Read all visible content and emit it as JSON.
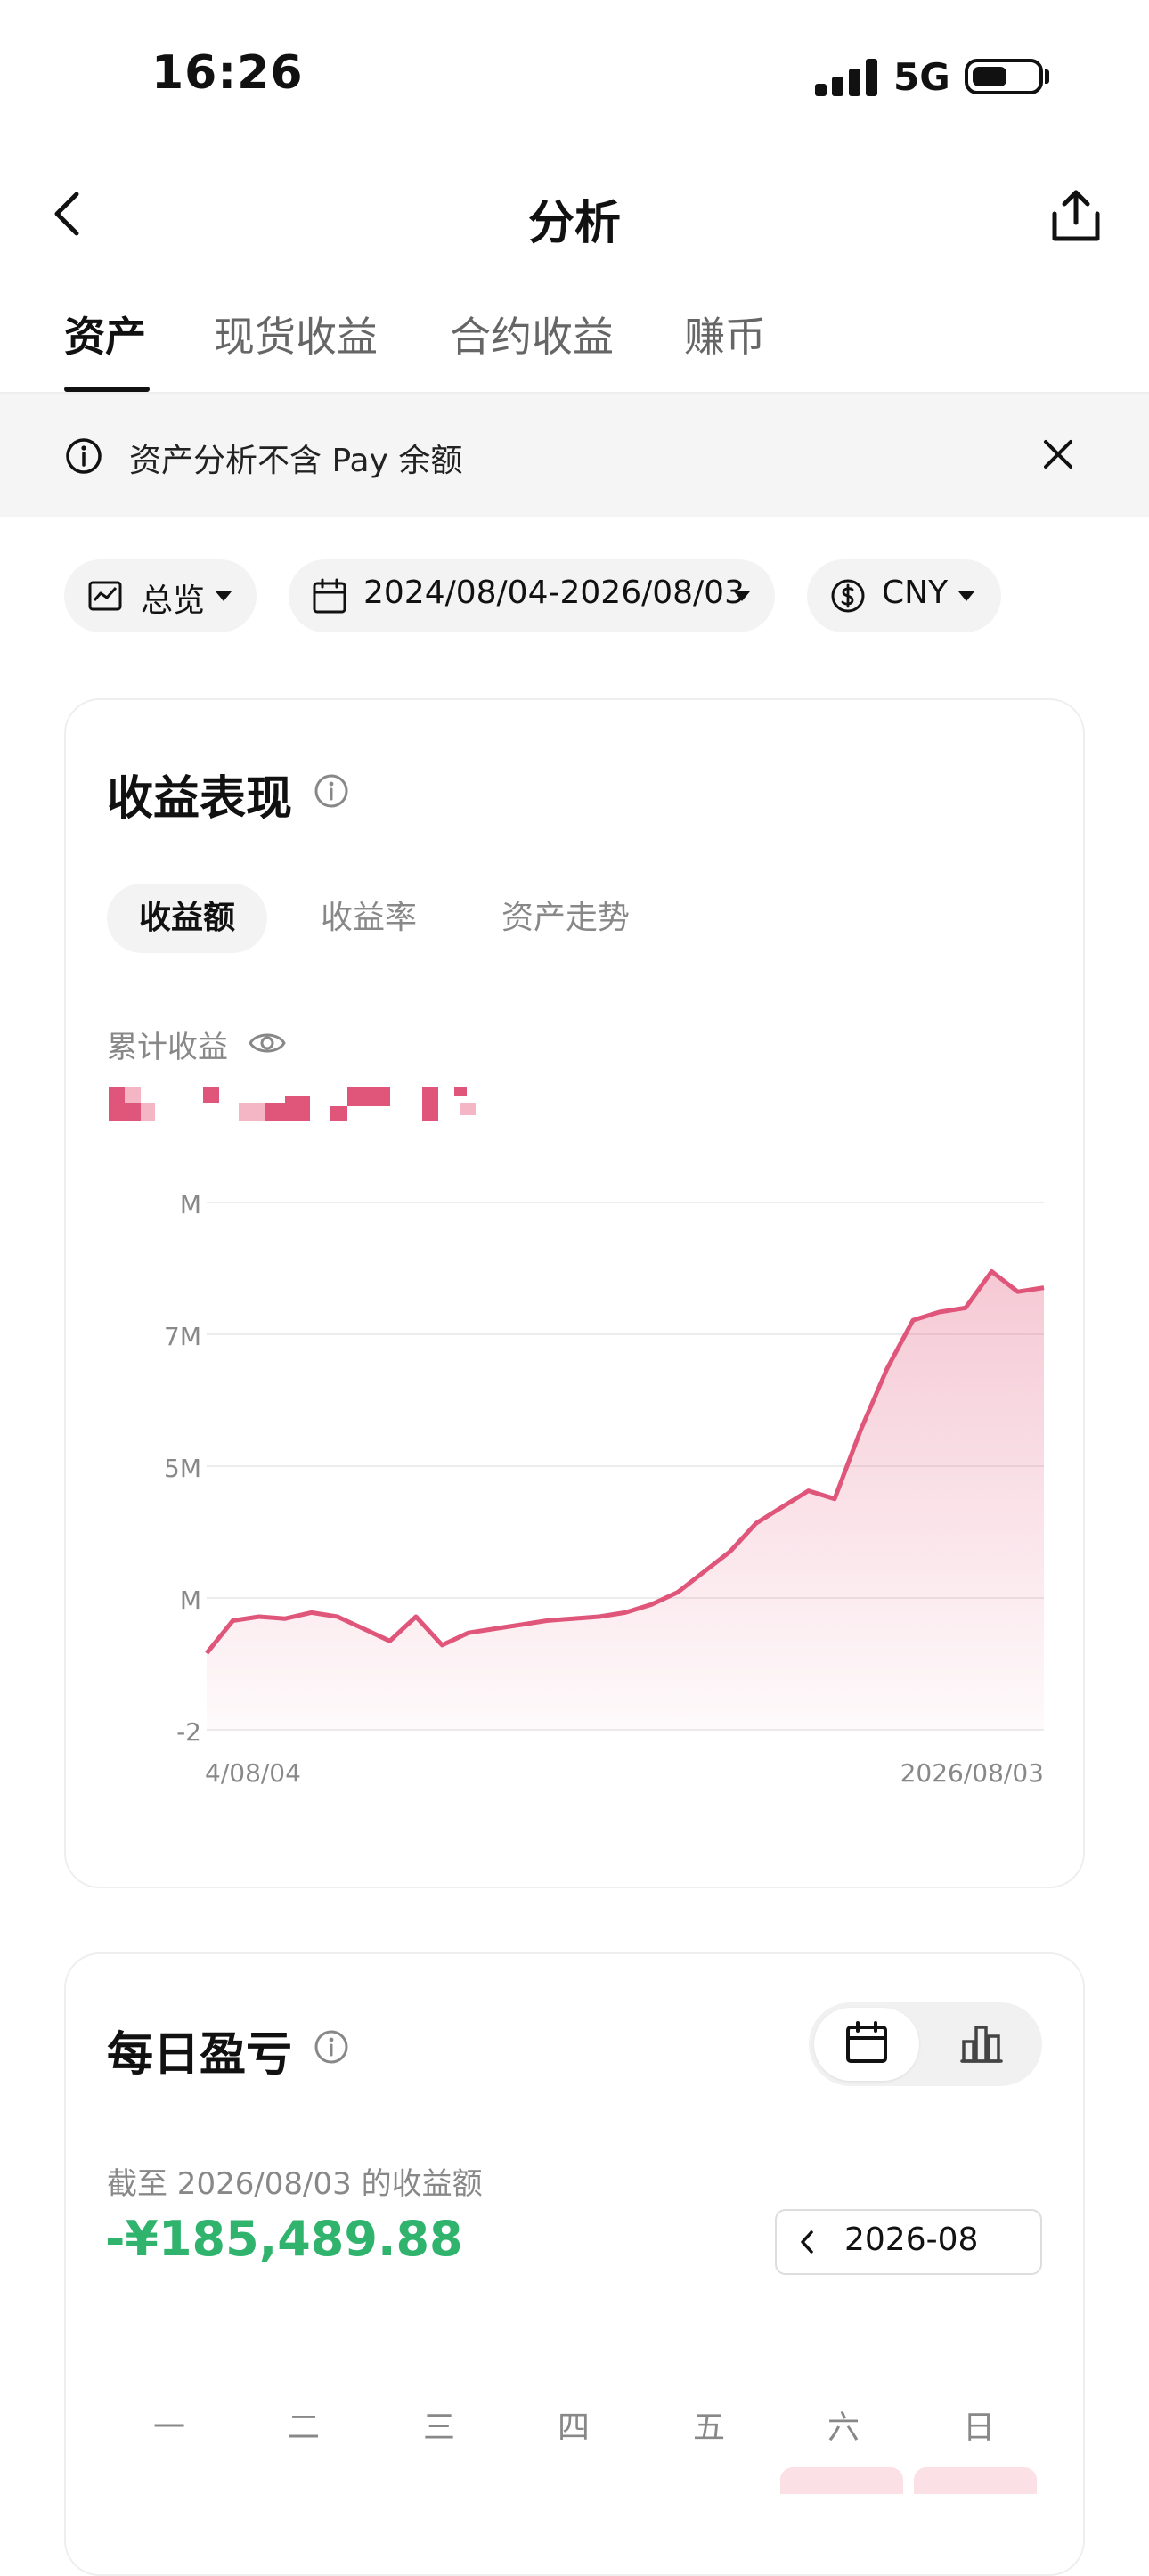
{
  "status_bar": {
    "time": "16:26",
    "network": "5G",
    "icons": [
      "signal-icon",
      "battery-icon"
    ]
  },
  "nav": {
    "title": "分析",
    "icons": [
      "back-icon",
      "share-icon"
    ]
  },
  "tabs": [
    {
      "label": "资产",
      "active": true
    },
    {
      "label": "现货收益",
      "active": false
    },
    {
      "label": "合约收益",
      "active": false
    },
    {
      "label": "赚币",
      "active": false
    }
  ],
  "notice": {
    "text": "资产分析不含 Pay 余额",
    "icons": [
      "info-icon",
      "close-icon"
    ]
  },
  "filters": {
    "view": "总览",
    "date_range": "2024/08/04-2026/08/03",
    "currency": "CNY"
  },
  "performance": {
    "title": "收益表现",
    "segments": [
      {
        "label": "收益额",
        "active": true
      },
      {
        "label": "收益率",
        "active": false
      },
      {
        "label": "资产走势",
        "active": false
      }
    ],
    "cumulative_label": "累计收益"
  },
  "chart_data": {
    "type": "area",
    "x_start_label": "4/08/04",
    "x_end_label": "2026/08/03",
    "y_tick_labels": [
      "-2",
      "M",
      "5M",
      "7M",
      "M"
    ],
    "grid": true,
    "color": "#e0567a",
    "series_shape": [
      0.0,
      0.08,
      0.09,
      0.085,
      0.1,
      0.09,
      0.06,
      0.03,
      0.09,
      0.02,
      0.05,
      0.06,
      0.07,
      0.08,
      0.085,
      0.09,
      0.1,
      0.12,
      0.15,
      0.2,
      0.25,
      0.32,
      0.36,
      0.4,
      0.38,
      0.55,
      0.7,
      0.82,
      0.84,
      0.85,
      0.94,
      0.89,
      0.9
    ]
  },
  "daily_pnl": {
    "title": "每日盈亏",
    "as_of": "截至 2026/08/03 的收益额",
    "value": "-¥185,489.88",
    "month": "2026-08",
    "weekdays": [
      "一",
      "二",
      "三",
      "四",
      "五",
      "六",
      "日"
    ],
    "icons": [
      "calendar-icon",
      "bar-chart-icon",
      "chevron-left-icon",
      "info-icon"
    ],
    "value_color": "#2fb36d"
  }
}
